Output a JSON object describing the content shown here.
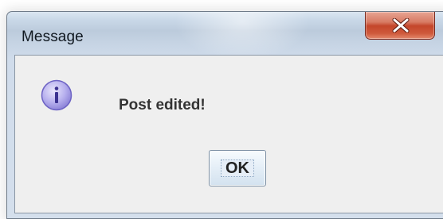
{
  "window": {
    "title": "Message"
  },
  "dialog": {
    "message": "Post edited!",
    "icon": "info-icon"
  },
  "buttons": {
    "ok_label": "OK",
    "close_icon": "close-icon"
  },
  "colors": {
    "close_button": "#c4462b",
    "client_background": "#efefef",
    "info_icon": "#8f86d9"
  }
}
